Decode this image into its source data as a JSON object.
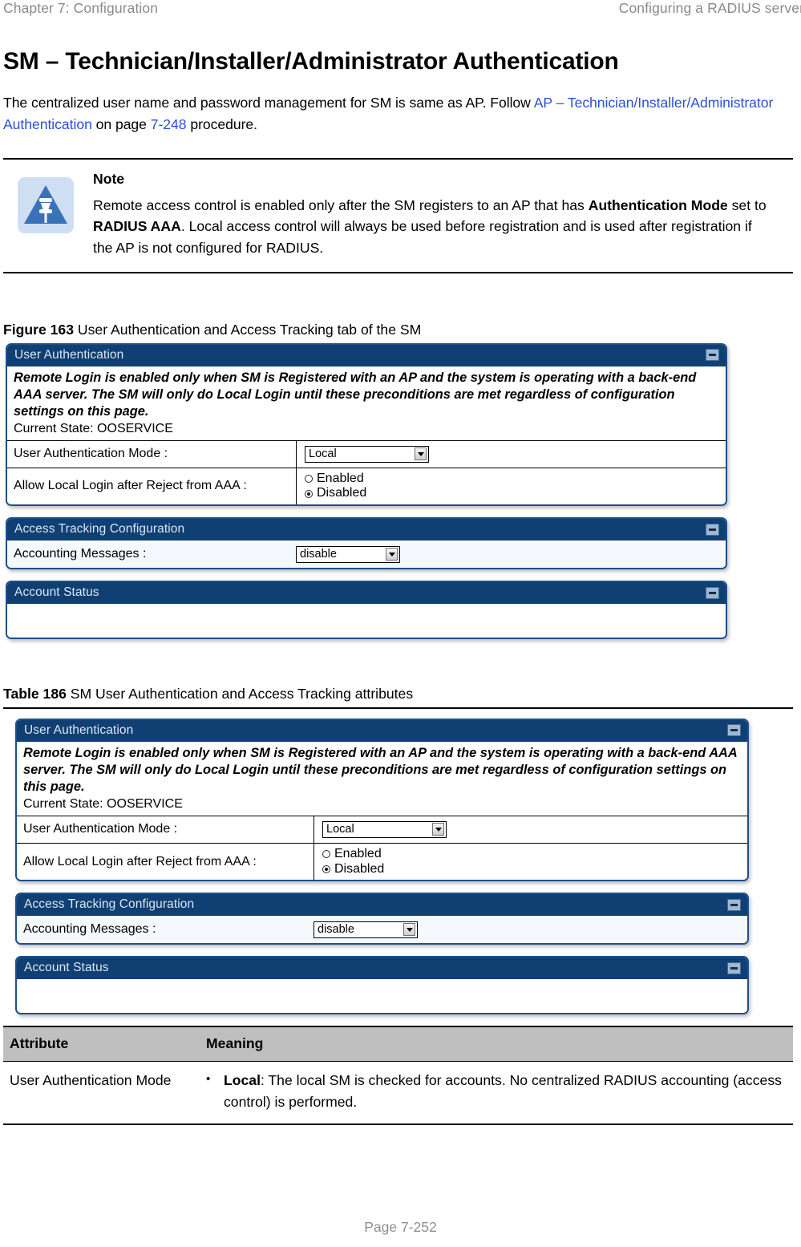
{
  "header": {
    "left": "Chapter 7:  Configuration",
    "right": "Configuring a RADIUS server"
  },
  "title": "SM – Technician/Installer/Administrator Authentication",
  "intro_paragraph": {
    "part1": "The centralized user name and password management for SM is same as AP. Follow ",
    "link1": "AP – Technician/Installer/Administrator Authentication",
    "part2": " on page ",
    "link2": "7-248",
    "part3": " procedure."
  },
  "note": {
    "icon": "note-pushpin-icon",
    "title": "Note",
    "text_part1": "Remote access control is enabled only after the SM registers to an AP that has ",
    "bold1": "Authentication Mode",
    "text_part2": " set to ",
    "bold2": "RADIUS AAA",
    "text_part3": ". Local access control will always be used before registration and is used after registration if the AP is not configured for RADIUS."
  },
  "figure": {
    "label": "Figure 163",
    "caption": " User Authentication and Access Tracking tab of the SM"
  },
  "table_caption": {
    "label": "Table 186",
    "caption": " SM User Authentication and Access Tracking attributes"
  },
  "screenshot": {
    "user_auth": {
      "header": "User Authentication",
      "minimize_icon": "minimize-icon",
      "intro": "Remote Login is enabled only when SM is Registered with an AP and the system is operating with a back-end AAA server. The SM will only do Local Login until these preconditions are met regardless of configuration settings on this page.",
      "current_state": "Current State: OOSERVICE",
      "mode_label": "User Authentication Mode :",
      "mode_value": "Local",
      "allow_label": "Allow Local Login after Reject from AAA :",
      "radio_enabled": "Enabled",
      "radio_disabled": "Disabled",
      "radio_selected": "Disabled"
    },
    "access_tracking": {
      "header": "Access Tracking Configuration",
      "minimize_icon": "minimize-icon",
      "accounting_label": "Accounting Messages :",
      "accounting_value": "disable"
    },
    "account_status": {
      "header": "Account Status",
      "minimize_icon": "minimize-icon"
    }
  },
  "attributes_table": {
    "columns": [
      "Attribute",
      "Meaning"
    ],
    "rows": [
      {
        "attribute": "User Authentication Mode",
        "bullet_dot": "•",
        "meaning_bold": "Local",
        "meaning_text": ": The local SM is checked for accounts. No centralized RADIUS accounting (access control) is performed."
      }
    ]
  },
  "footer": "Page 7-252",
  "colors": {
    "panel_header": "#103f73",
    "panel_border": "#1d4f8c",
    "link": "#2a4fd7",
    "table_header_bg": "#bfbfbf",
    "note_icon_bg": "#cfdff3",
    "note_icon_fg": "#3a72b8"
  }
}
